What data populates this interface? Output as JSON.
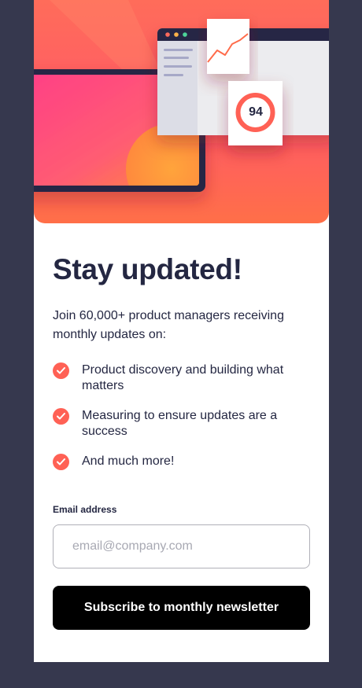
{
  "hero": {
    "score": "94",
    "illustration": "laptop and dashboard illustration",
    "colors": {
      "accent": "#ff6155",
      "dark": "#242742",
      "background": "#36384e"
    }
  },
  "signup": {
    "title": "Stay updated!",
    "intro": "Join 60,000+ product managers receiving monthly updates on:",
    "features": [
      {
        "icon": "check-icon",
        "text": "Product discovery and building what matters"
      },
      {
        "icon": "check-icon",
        "text": "Measuring to ensure updates are a success"
      },
      {
        "icon": "check-icon",
        "text": "And much more!"
      }
    ],
    "email_label": "Email address",
    "email_placeholder": "email@company.com",
    "email_value": "",
    "button_label": "Subscribe to monthly newsletter"
  }
}
